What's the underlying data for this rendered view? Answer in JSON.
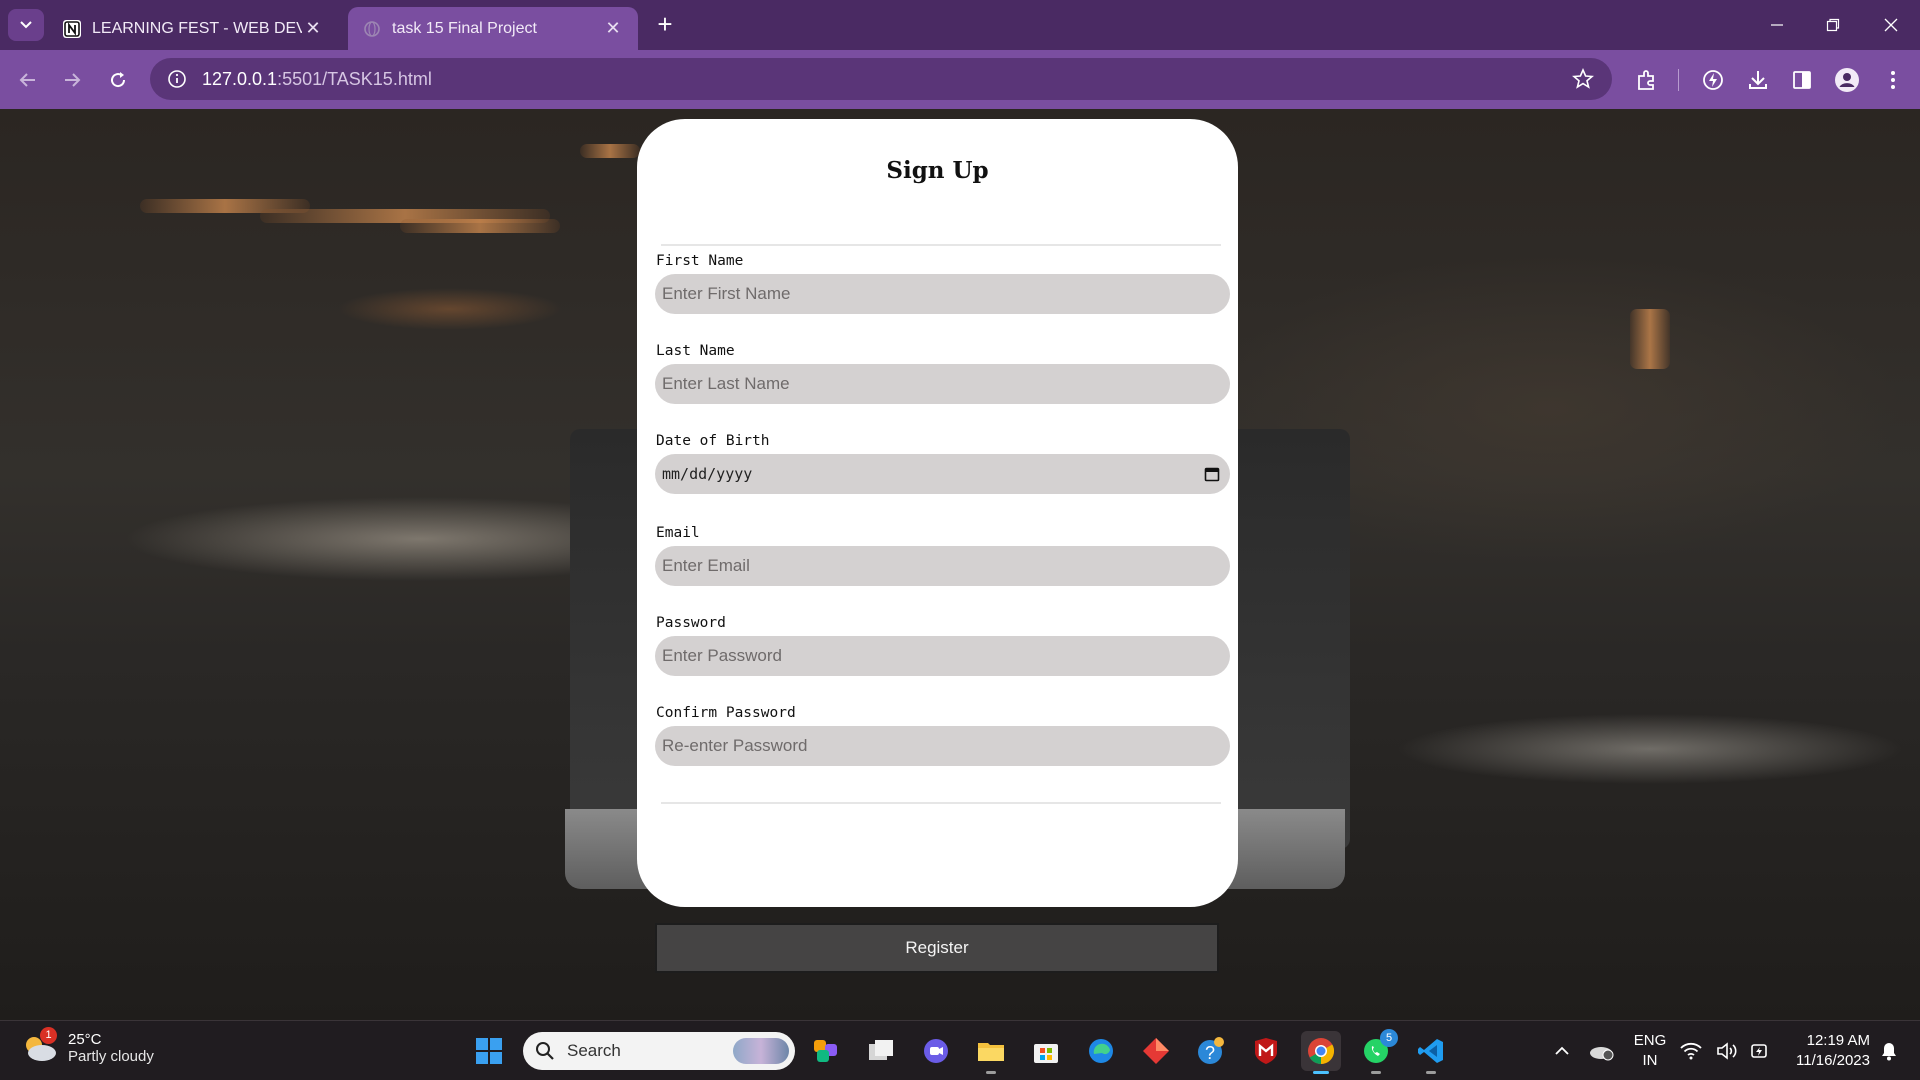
{
  "browser": {
    "tabs": [
      {
        "title": "LEARNING FEST - WEB DEVELO",
        "active": false
      },
      {
        "title": "task 15 Final Project",
        "active": true
      }
    ],
    "url_host": "127.0.0.1",
    "url_rest": ":5501/TASK15.html"
  },
  "form": {
    "title": "Sign Up",
    "fields": [
      {
        "label": "First Name",
        "placeholder": "Enter First Name"
      },
      {
        "label": "Last Name",
        "placeholder": "Enter Last Name"
      },
      {
        "label": "Date of Birth",
        "placeholder": "mm/dd/yyyy"
      },
      {
        "label": "Email",
        "placeholder": "Enter Email"
      },
      {
        "label": "Password",
        "placeholder": "Enter Password"
      },
      {
        "label": "Confirm Password",
        "placeholder": "Re-enter Password"
      }
    ],
    "submit_label": "Register"
  },
  "taskbar": {
    "weather_temp": "25°C",
    "weather_condition": "Partly cloudy",
    "weather_badge": "1",
    "search_label": "Search",
    "whatsapp_badge": "5",
    "lang_line1": "ENG",
    "lang_line2": "IN",
    "time": "12:19 AM",
    "date": "11/16/2023"
  },
  "colors": {
    "chrome_dark": "#4a2a63",
    "chrome_light": "#7a4ea0",
    "input_bg": "#d4d1d1",
    "button_bg": "#454444"
  }
}
